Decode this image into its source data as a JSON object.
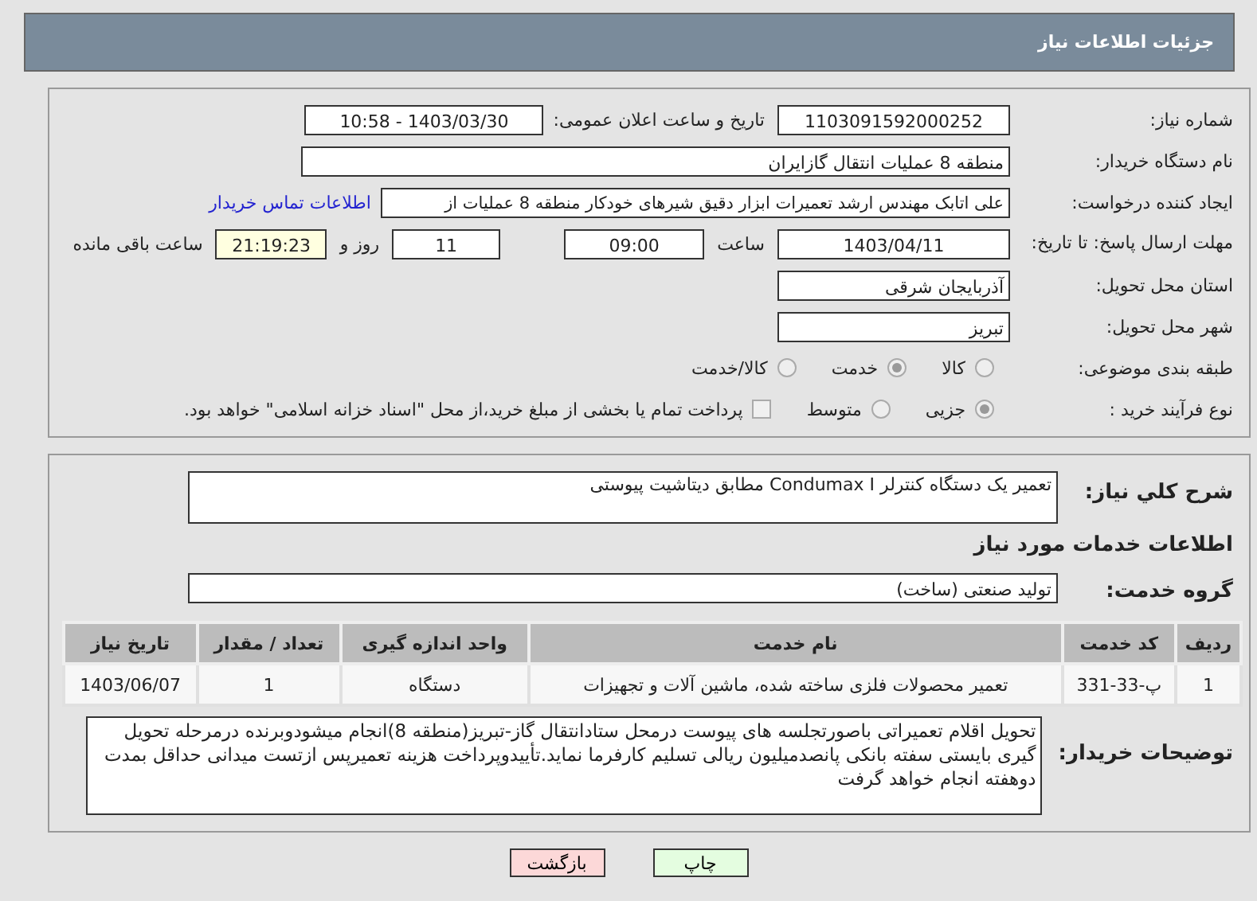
{
  "header": {
    "title": "جزئیات اطلاعات نیاز"
  },
  "need_number": {
    "label": "شماره نیاز:",
    "value": "1103091592000252"
  },
  "announce": {
    "label": "تاریخ و ساعت اعلان عمومی:",
    "value": "1403/03/30 - 10:58"
  },
  "buyer_org": {
    "label": "نام دستگاه خریدار:",
    "value": "منطقه 8 عملیات انتقال گازایران"
  },
  "creator": {
    "label": "ایجاد کننده درخواست:",
    "value": "علی اتابک مهندس ارشد تعمیرات ابزار دقیق شیرهای خودکار منطقه 8 عملیات از",
    "link": "اطلاعات تماس خریدار"
  },
  "deadline": {
    "label": "مهلت ارسال پاسخ: تا تاریخ:",
    "date": "1403/04/11",
    "time_label": "ساعت",
    "time": "09:00",
    "days": "11",
    "days_label": "روز و",
    "remaining": "21:19:23",
    "remaining_label": "ساعت باقی مانده"
  },
  "province": {
    "label": "استان محل تحویل:",
    "value": "آذربایجان شرقی"
  },
  "city": {
    "label": "شهر محل تحویل:",
    "value": "تبریز"
  },
  "classification": {
    "label": "طبقه بندی موضوعی:",
    "options": [
      {
        "label": "کالا",
        "selected": false
      },
      {
        "label": "خدمت",
        "selected": true
      },
      {
        "label": "کالا/خدمت",
        "selected": false
      }
    ]
  },
  "process": {
    "label": "نوع فرآیند خرید :",
    "options": [
      {
        "label": "جزیی",
        "selected": true
      },
      {
        "label": "متوسط",
        "selected": false
      }
    ],
    "prepay": {
      "label": "پرداخت تمام یا بخشی از مبلغ خرید،از محل \"اسناد خزانه اسلامی\" خواهد بود.",
      "checked": false
    }
  },
  "summary": {
    "label": "شرح کلي نياز:",
    "value": "تعمیر یک دستگاه کنترلر Condumax I  مطابق دیتاشیت پیوستی"
  },
  "services_heading": "اطلاعات خدمات مورد نیاز",
  "service_group": {
    "label": "گروه خدمت:",
    "value": "تولید صنعتی (ساخت)"
  },
  "table": {
    "columns": [
      "ردیف",
      "کد خدمت",
      "نام خدمت",
      "واحد اندازه گیری",
      "تعداد / مقدار",
      "تاریخ نیاز"
    ],
    "rows": [
      [
        "1",
        "پ-33-331",
        "تعمیر محصولات فلزی ساخته شده، ماشین آلات و تجهیزات",
        "دستگاه",
        "1",
        "1403/06/07"
      ]
    ]
  },
  "buyer_notes": {
    "label": "توضیحات خریدار:",
    "value": "تحویل اقلام تعمیراتی باصورتجلسه های پیوست درمحل ستادانتقال گاز-تبریز(منطقه 8)انجام میشودوبرنده درمرحله تحویل گیری بایستی سفته بانکی پانصدمیلیون ریالی تسلیم کارفرما نماید.تأییدوپرداخت هزینه تعمیرپس ازتست میدانی حداقل بمدت دوهفته انجام خواهد گرفت"
  },
  "buttons": [
    {
      "label": "چاپ",
      "kind": "print"
    },
    {
      "label": "بازگشت",
      "kind": "back"
    }
  ]
}
